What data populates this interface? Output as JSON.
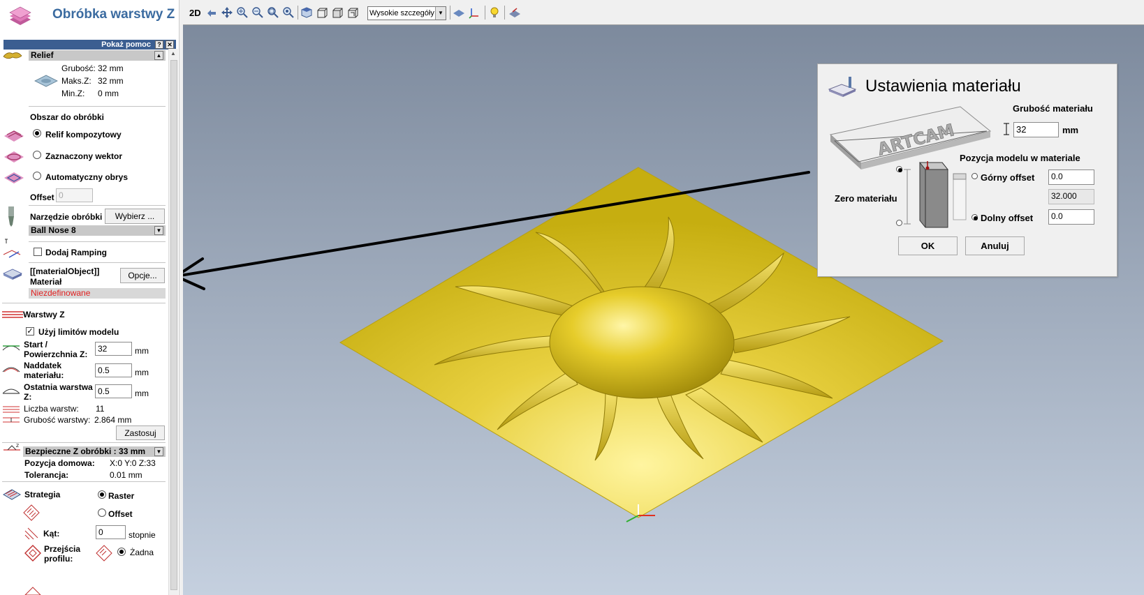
{
  "panel": {
    "title": "Obróbka warstwy Z",
    "help_label": "Pokaż pomoc",
    "help_btn": "?",
    "close_btn": "✕",
    "relief": {
      "header": "Relief",
      "thickness_label": "Grubość:",
      "thickness_value": "32 mm",
      "maxz_label": "Maks.Z:",
      "maxz_value": "32 mm",
      "minz_label": "Min.Z:",
      "minz_value": "0 mm"
    },
    "area": {
      "heading": "Obszar do obróbki",
      "options": [
        "Relif kompozytowy",
        "Zaznaczony wektor",
        "Automatyczny obrys"
      ],
      "selected": "Relif kompozytowy",
      "offset_label": "Offset",
      "offset_value": "0"
    },
    "tool": {
      "label": "Narzędzie obróbki",
      "select_button": "Wybierz ...",
      "tool_name": "Ball Nose 8"
    },
    "ramping": {
      "label": "Dodaj Ramping",
      "checked": false
    },
    "material": {
      "line1": "[[materialObject]]",
      "line2": "Materiał",
      "options_button": "Opcje...",
      "status": "Niezdefinowane"
    },
    "z_layers": {
      "heading": "Warstwy Z",
      "use_limits_label": "Użyj limitów modelu",
      "use_limits_checked": true,
      "start_label_1": "Start /",
      "start_label_2": "Powierzchnia Z:",
      "start_value": "32",
      "allowance_label_1": "Naddatek",
      "allowance_label_2": "materiału:",
      "allowance_value": "0.5",
      "last_label_1": "Ostatnia warstwa",
      "last_label_2": "Z:",
      "last_value": "0.5",
      "unit": "mm",
      "count_label": "Liczba warstw:",
      "count_value": "11",
      "thickness_label": "Grubość warstwy:",
      "thickness_value": "2.864 mm",
      "apply_button": "Zastosuj"
    },
    "safe_z": {
      "header": "Bezpieczne Z obróbki : 33 mm",
      "home_label": "Pozycja domowa:",
      "home_value": "X:0 Y:0 Z:33",
      "tolerance_label": "Tolerancja:",
      "tolerance_value": "0.01 mm"
    },
    "strategy": {
      "heading": "Strategia",
      "raster_label": "Raster",
      "offset_label": "Offset",
      "selected": "Raster",
      "angle_label": "Kąt:",
      "angle_value": "0",
      "angle_unit": "stopnie",
      "profile_label_1": "Przejścia",
      "profile_label_2": "profilu:",
      "profile_none": "Żadna"
    }
  },
  "toolbar": {
    "label_2d": "2D",
    "detail_select": "Wysokie szczegóły"
  },
  "dialog": {
    "title": "Ustawienia materiału",
    "thickness_label": "Grubość materiału",
    "thickness_value": "32",
    "thickness_unit": "mm",
    "position_label": "Pozycja modelu w materiale",
    "zero_label": "Zero materiału",
    "top_offset_label": "Górny offset",
    "top_offset_value": "0.0",
    "middle_value": "32.000",
    "bottom_offset_label": "Dolny offset",
    "bottom_offset_value": "0.0",
    "selected_offset": "Dolny offset",
    "ok_button": "OK",
    "cancel_button": "Anuluj",
    "block_text": "ARTCAM"
  },
  "colors": {
    "accent_title": "#3b6ba0",
    "help_bar": "#3b5e91",
    "relief_gold": "#d8c020",
    "status_red": "#e02020"
  }
}
